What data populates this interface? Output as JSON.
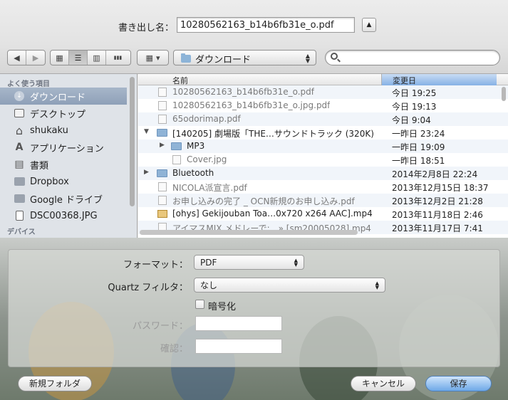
{
  "export": {
    "label": "書き出し名：",
    "value": "10280562163_b14b6fb31e_o.pdf",
    "expand_glyph": "▲"
  },
  "toolbar": {
    "back_glyph": "◀",
    "forward_glyph": "▶",
    "view_icon_glyph": "▦",
    "view_list_glyph": "☰",
    "view_column_glyph": "▥",
    "view_flow_glyph": "▮▮▮",
    "arrange_glyph": "▦",
    "arrange_arrow": "▾",
    "location": "ダウンロード",
    "updown_up": "▲",
    "updown_down": "▼"
  },
  "sidebar": {
    "favorites_header": "よく使う項目",
    "devices_header": "デバイス",
    "items": [
      {
        "label": "ダウンロード",
        "icon": "download-icon",
        "glyph": "↓"
      },
      {
        "label": "デスクトップ",
        "icon": "desktop-icon",
        "glyph": ""
      },
      {
        "label": "shukaku",
        "icon": "home-icon",
        "glyph": "⌂"
      },
      {
        "label": "アプリケーション",
        "icon": "applications-icon",
        "glyph": "A"
      },
      {
        "label": "書類",
        "icon": "documents-icon",
        "glyph": "▤"
      },
      {
        "label": "Dropbox",
        "icon": "folder-icon",
        "glyph": ""
      },
      {
        "label": "Google ドライブ",
        "icon": "folder-icon",
        "glyph": ""
      },
      {
        "label": "DSC00368.JPG",
        "icon": "file-icon",
        "glyph": ""
      }
    ]
  },
  "filelist": {
    "col_name": "名前",
    "col_date": "変更日",
    "rows": [
      {
        "name": "10280562163_b14b6fb31e_o.pdf",
        "date": "今日 19:25"
      },
      {
        "name": "10280562163_b14b6fb31e_o.jpg.pdf",
        "date": "今日 19:13"
      },
      {
        "name": "65odorimap.pdf",
        "date": "今日 9:04"
      },
      {
        "name": "[140205] 劇場版「THE…サウンドトラック (320K)",
        "date": "一昨日 23:24",
        "tri": "▼"
      },
      {
        "name": "MP3",
        "date": "一昨日 19:09",
        "tri": "▶"
      },
      {
        "name": "Cover.jpg",
        "date": "一昨日 18:51"
      },
      {
        "name": "Bluetooth",
        "date": "2014年2月8日 22:24",
        "tri": "▶"
      },
      {
        "name": "NICOLA派宣言.pdf",
        "date": "2013年12月15日 18:37"
      },
      {
        "name": "お申し込みの完了 _ OCN新規のお申し込み.pdf",
        "date": "2013年12月2日 21:28"
      },
      {
        "name": "[ohys] Gekijouban Toa…0x720 x264 AAC].mp4",
        "date": "2013年11月18日 2:46"
      },
      {
        "name": "アイマスMIX メドレーで:…» [sm20005028].mp4",
        "date": "2013年11月17日 7:41"
      }
    ]
  },
  "options": {
    "format_label": "フォーマット：",
    "format_value": "PDF",
    "quartz_label": "Quartz フィルタ：",
    "quartz_value": "なし",
    "encrypt_label": "暗号化",
    "password_label": "パスワード：",
    "confirm_label": "確認："
  },
  "buttons": {
    "new_folder": "新規フォルダ",
    "cancel": "キャンセル",
    "save": "保存"
  }
}
